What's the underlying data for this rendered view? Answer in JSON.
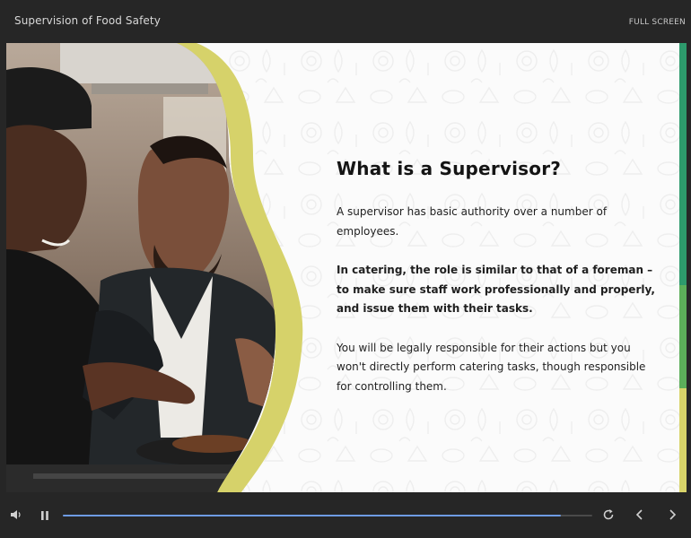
{
  "header": {
    "course_title": "Supervision of Food Safety",
    "fullscreen_label": "FULL SCREEN"
  },
  "slide": {
    "heading": "What is a Supervisor?",
    "paragraphs": {
      "p1": "A supervisor has basic authority over a number of employees.",
      "p2": "In catering, the role is similar to that of a foreman – to make sure staff work professionally and properly, and issue them with their tasks.",
      "p3": "You will be legally responsible for their actions but you won't directly perform catering tasks, though responsible for controlling them."
    },
    "colors": {
      "accent_curve": "#d6d26a",
      "heading": "#141414",
      "background": "#fbfbfb"
    }
  },
  "player": {
    "progress": 0.94,
    "icons": {
      "volume": "volume-icon",
      "pause": "pause-icon",
      "replay": "replay-icon",
      "prev": "chevron-left-icon",
      "next": "chevron-right-icon"
    },
    "colors": {
      "progress_fill": "#6e9be3",
      "side_strip_top": "#2d9a6c",
      "side_strip_bottom": "#d8d46a"
    }
  }
}
